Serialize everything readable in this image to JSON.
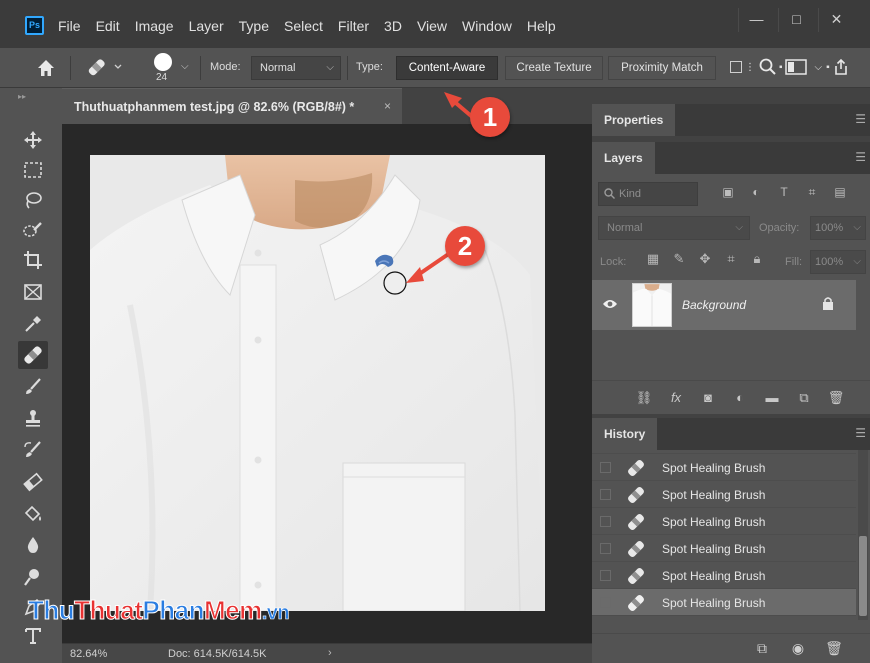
{
  "app": {
    "logo_text": "Ps",
    "menu": [
      "File",
      "Edit",
      "Image",
      "Layer",
      "Type",
      "Select",
      "Filter",
      "3D",
      "View",
      "Window",
      "Help"
    ],
    "window_controls": {
      "minimize": "—",
      "maximize": "□",
      "close": "✕"
    }
  },
  "options": {
    "brush_size": "24",
    "mode_label": "Mode:",
    "mode_value": "Normal",
    "type_label": "Type:",
    "type_buttons": [
      "Content-Aware",
      "Create Texture",
      "Proximity Match"
    ],
    "active_type": "Content-Aware"
  },
  "document": {
    "tab_title": "Thuthuatphanmem test.jpg @ 82.6% (RGB/8#) *",
    "close_glyph": "×",
    "zoom": "82.64%",
    "doc_size": "Doc: 614.5K/614.5K"
  },
  "panels": {
    "properties_tab": "Properties",
    "layers_tab": "Layers",
    "history_tab": "History",
    "kind_placeholder": "Kind",
    "blend_mode": "Normal",
    "opacity_label": "Opacity:",
    "opacity_value": "100%",
    "lock_label": "Lock:",
    "fill_label": "Fill:",
    "fill_value": "100%",
    "layer_name": "Background",
    "history_items": [
      "Spot Healing Brush",
      "Spot Healing Brush",
      "Spot Healing Brush",
      "Spot Healing Brush",
      "Spot Healing Brush",
      "Spot Healing Brush"
    ]
  },
  "annotations": {
    "step1": "1",
    "step2": "2"
  },
  "watermark": {
    "part1": "Thu",
    "part2": "Thuat",
    "part3": "Phan",
    "part4": "Mem",
    "part5": ".vn"
  },
  "colors": {
    "accent": "#31a8ff",
    "callout": "#e84a3b",
    "panel_bg": "#535353",
    "canvas_bg": "#282828"
  }
}
